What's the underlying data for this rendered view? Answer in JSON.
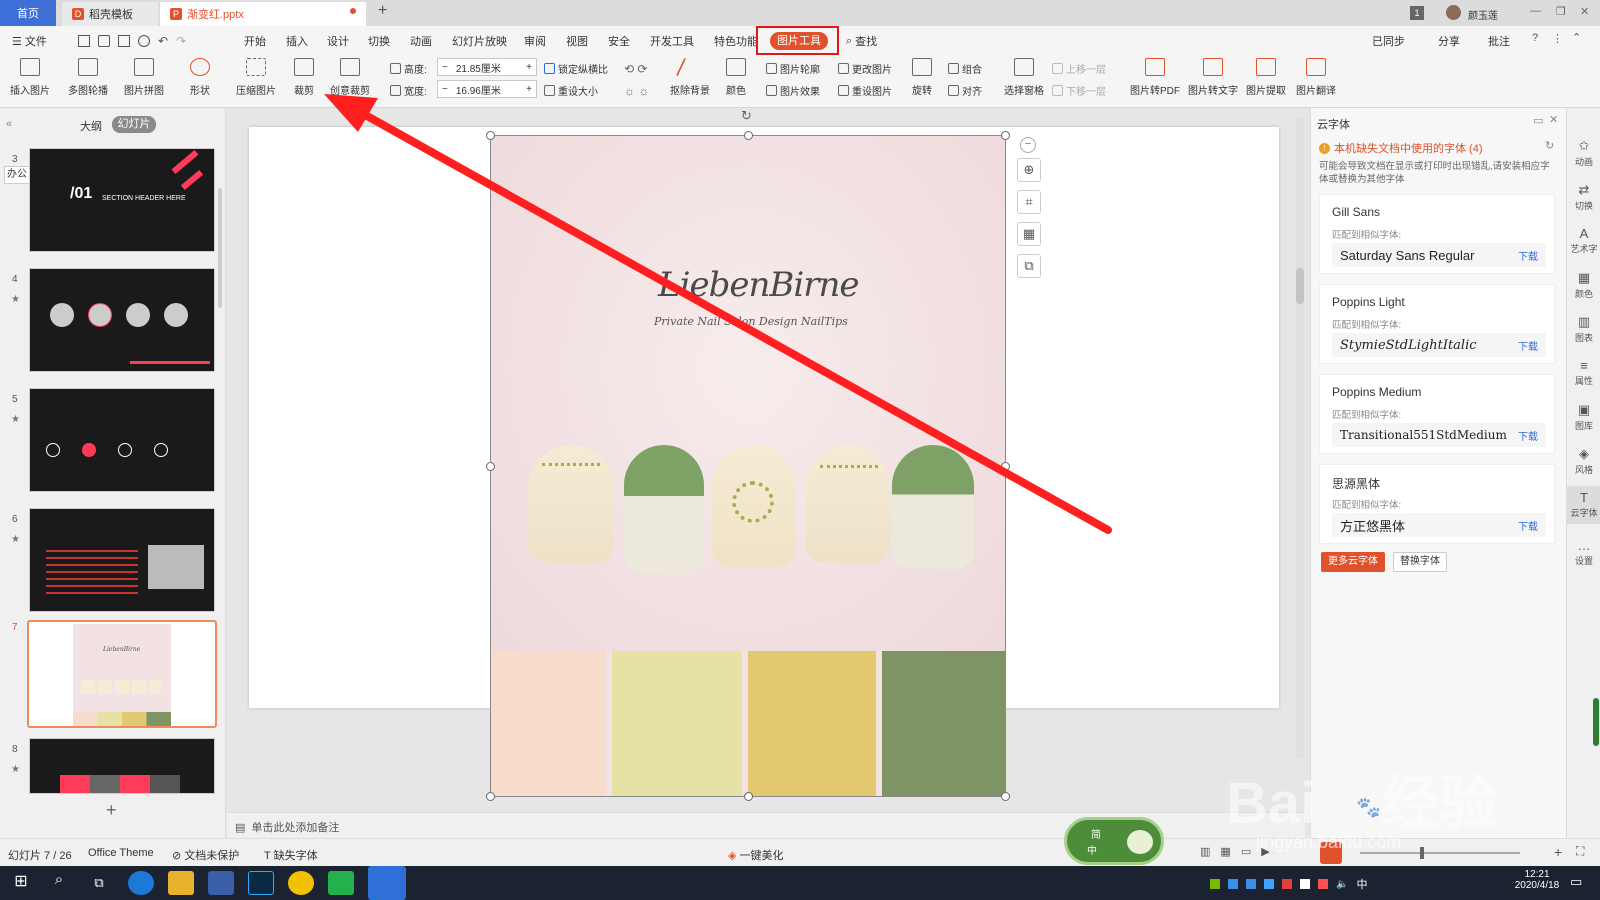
{
  "tabs": {
    "home": "首页",
    "template": "稻壳模板",
    "doc": "渐变红.pptx",
    "new_tab": "+",
    "badge": "1",
    "user": "颜玉莲"
  },
  "window_controls": {
    "min": "—",
    "restore": "❐",
    "close": "✕"
  },
  "menubar": {
    "file": "☰ 文件",
    "items": [
      "开始",
      "插入",
      "设计",
      "切换",
      "动画",
      "幻灯片放映",
      "审阅",
      "视图",
      "安全",
      "开发工具",
      "特色功能"
    ],
    "active": "图片工具",
    "search": "查找",
    "sync": "已同步",
    "share": "分享",
    "comment": "批注"
  },
  "ribbon": {
    "insert_pic": "插入图片",
    "multi_border": "多图轮播",
    "collage": "图片拼图",
    "shape": "形状",
    "compress": "压缩图片",
    "crop": "裁剪",
    "creative_crop": "创意裁剪",
    "height_label": "高度:",
    "height_value": "21.85厘米",
    "width_label": "宽度:",
    "width_value": "16.96厘米",
    "lock_ratio": "锁定纵横比",
    "reset_size": "重设大小",
    "remove_bg": "抠除背景",
    "color": "颜色",
    "pic_outline": "图片轮廓",
    "change_pic": "更改图片",
    "pic_effect": "图片效果",
    "reset_pic": "重设图片",
    "rotate": "旋转",
    "group": "组合",
    "align": "对齐",
    "select_pane": "选择窗格",
    "bring_forward": "上移一层",
    "send_backward": "下移一层",
    "to_pdf": "图片转PDF",
    "to_text": "图片转文字",
    "extract": "图片提取",
    "translate": "图片翻译"
  },
  "leftpane": {
    "outline": "大纲",
    "slides": "幻灯片",
    "office_badge": "办公",
    "add": "+",
    "slide_numbers": [
      "3",
      "4",
      "5",
      "6",
      "7",
      "8"
    ],
    "slide3_title": "/01",
    "slide3_subtitle": "SECTION HEADER HERE"
  },
  "slide": {
    "brand": "LiebenBirne",
    "tagline": "Private Nail Salon Design NailTips",
    "swatch_colors": [
      "#f8dccb",
      "#e6e2a6",
      "#e2c96f",
      "#7e9464"
    ]
  },
  "rightpane": {
    "title": "云字体",
    "warning": "本机缺失文档中使用的字体 (4)",
    "desc": "可能会导致文档在显示或打印时出现错乱,请安装相应字体或替换为其他字体",
    "match_label": "匹配到相似字体:",
    "download": "下载",
    "fonts": [
      {
        "name": "Gill Sans",
        "match": "Saturday Sans Regular"
      },
      {
        "name": "Poppins Light",
        "match": "StymieStdLightItalic"
      },
      {
        "name": "Poppins Medium",
        "match": "Transitional551StdMedium"
      },
      {
        "name": "思源黑体",
        "match": "方正悠黑体"
      }
    ],
    "more_fonts": "更多云字体",
    "replace_font": "替换字体"
  },
  "rightstrip": [
    "动画",
    "切换",
    "艺术字",
    "颜色",
    "图表",
    "属性",
    "图库",
    "风格",
    "云字体",
    "设置"
  ],
  "notes": {
    "placeholder": "单击此处添加备注"
  },
  "status": {
    "slide_pos": "幻灯片 7 / 26",
    "theme": "Office Theme",
    "protect": "文档未保护",
    "missing_font": "缺失字体",
    "beautify": "一键美化"
  },
  "ime": {
    "mode": "简",
    "lang": "中"
  },
  "tray": {
    "time": "12:21",
    "date": "2020/4/18",
    "ime": "中"
  },
  "watermark": {
    "brand": "Bai",
    "brand2": "经验",
    "url": "jingyan.baidu.com"
  },
  "colors": {
    "accent": "#e0522b",
    "highlight_border": "#e01818",
    "arrow": "#ff1f1f"
  }
}
